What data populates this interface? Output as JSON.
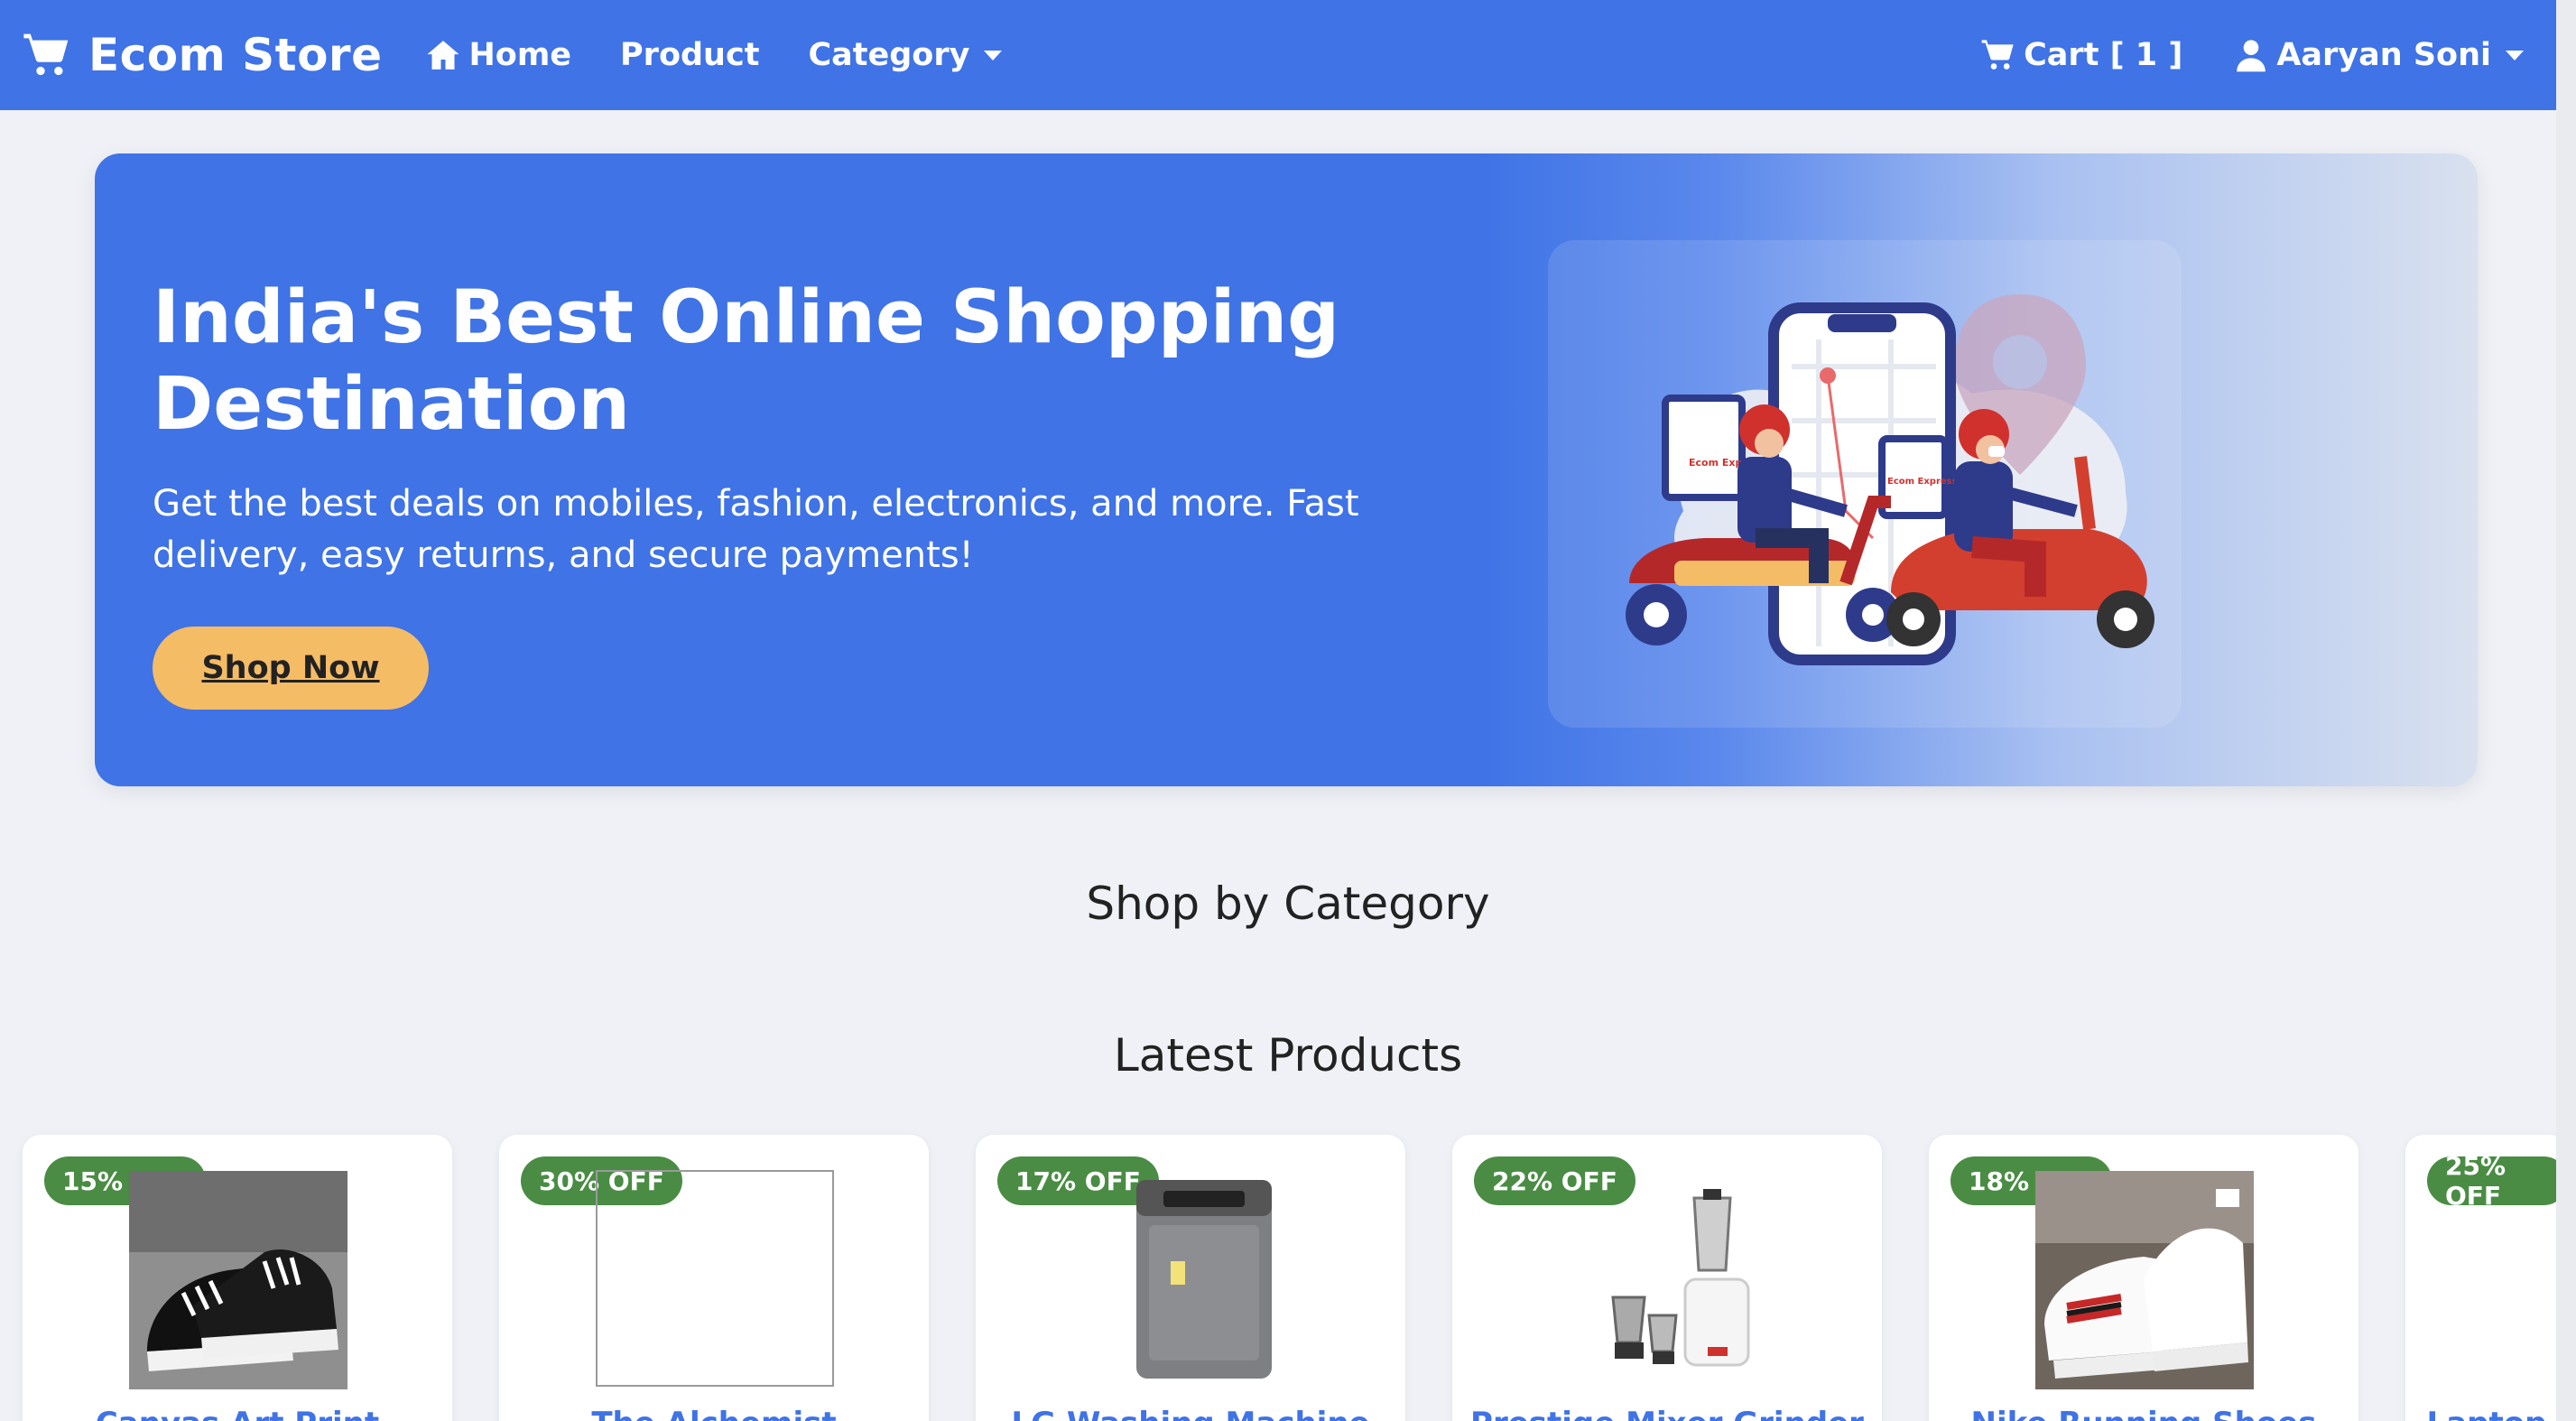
{
  "navbar": {
    "brand": "Ecom Store",
    "home": "Home",
    "product": "Product",
    "category": "Category",
    "cart": "Cart [ 1 ]",
    "user": "Aaryan Soni"
  },
  "hero": {
    "title": "India's Best Online Shopping Destination",
    "subtitle": "Get the best deals on mobiles, fashion, electronics, and more. Fast delivery, easy returns, and secure payments!",
    "cta": "Shop Now",
    "box_text_1": "Ecom Express",
    "box_text_2": "Ecom Express"
  },
  "sections": {
    "category_title": "Shop by Category",
    "latest_title": "Latest Products"
  },
  "products": [
    {
      "discount": "15% OFF",
      "name": "Canvas Art Print",
      "image": "sneakers-black"
    },
    {
      "discount": "30% OFF",
      "name": "The Alchemist",
      "image": "blank"
    },
    {
      "discount": "17% OFF",
      "name": "LG Washing Machine",
      "image": "washing-machine"
    },
    {
      "discount": "22% OFF",
      "name": "Prestige Mixer Grinder",
      "image": "mixer-grinder"
    },
    {
      "discount": "18% OFF",
      "name": "Nike Running Shoes",
      "image": "sneakers-white"
    },
    {
      "discount": "25% OFF",
      "name": "Laptop",
      "image": "laptop"
    }
  ],
  "colors": {
    "primary": "#3f73e6",
    "accent": "#f5bc66",
    "badge": "#4a8c44",
    "background": "#eff1f6"
  }
}
